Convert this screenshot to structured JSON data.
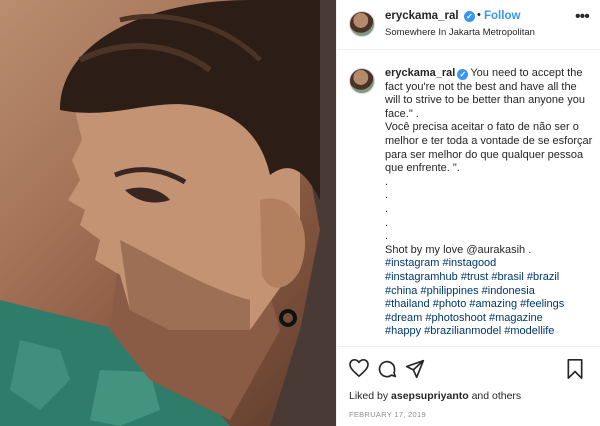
{
  "header": {
    "username": "eryckama_ral",
    "follow_label": "Follow",
    "separator": "•",
    "location": "Somewhere In Jakarta Metropolitan",
    "more_icon": "more-options-icon"
  },
  "caption": {
    "username": "eryckama_ral",
    "lines": [
      "You need to accept the fact you're not the best and have all the will to strive to be better than anyone you face.\" .",
      "Você precisa aceitar o fato de não ser o melhor e ter toda a vontade de se esforçar para ser melhor do que qualquer pessoa que enfrente. \".",
      ".",
      ".",
      ".",
      ".",
      ".",
      "Shot by my love @aurakasih ."
    ],
    "hashtags": [
      "#instagram #instagood",
      "#instagramhub #trust #brasil #brazil",
      "#china #philippines #indonesia",
      "#thailand #photo #amazing #feelings",
      "#dream #photoshoot #magazine",
      "#happy #brazilianmodel #modellife"
    ]
  },
  "actions": {
    "icons": [
      "heart-icon",
      "comment-icon",
      "share-icon",
      "bookmark-icon"
    ],
    "likes_prefix": "Liked by",
    "likes_user": "asepsupriyanto",
    "likes_suffix": "and others",
    "date": "FEBRUARY 17, 2019"
  },
  "colors": {
    "accent": "#3897f0",
    "hashtag": "#00376b",
    "text": "#262626",
    "muted": "#8e8e8e"
  }
}
